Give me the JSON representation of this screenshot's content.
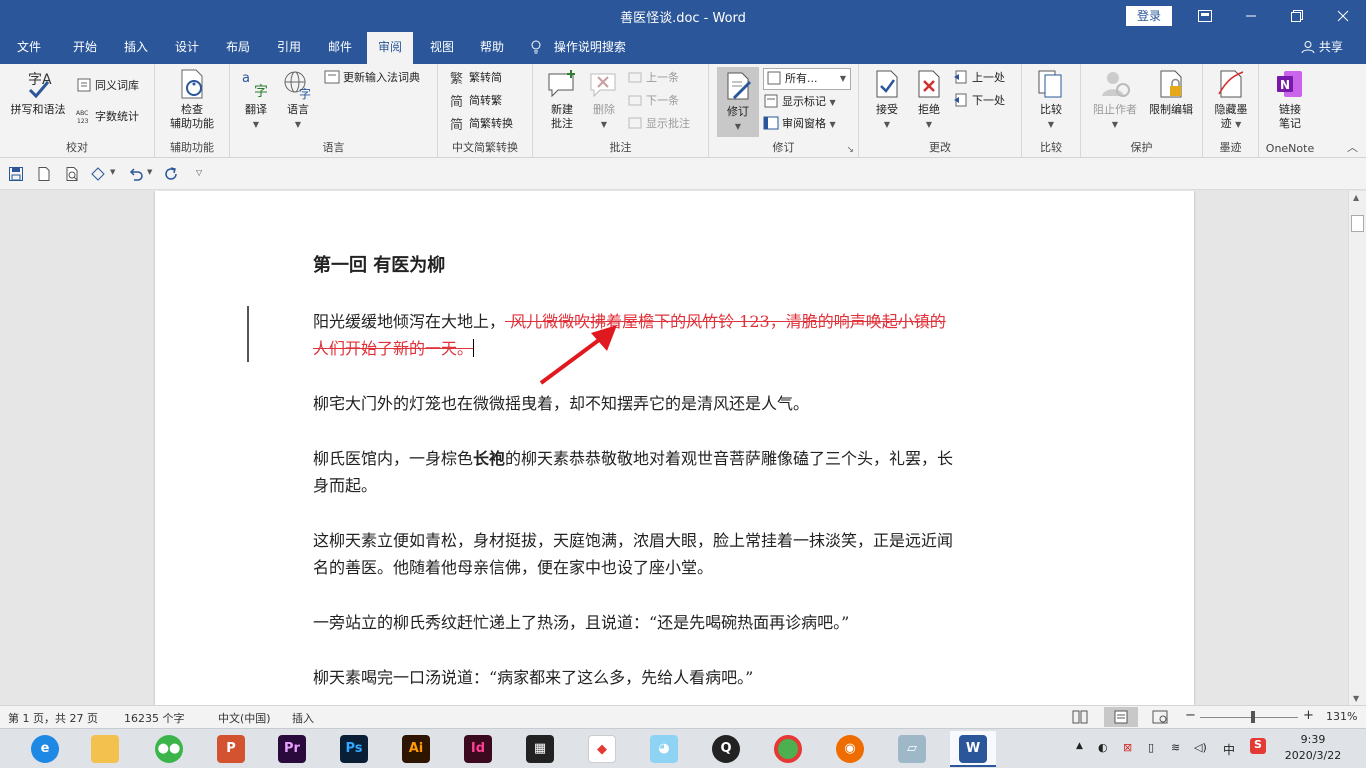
{
  "window": {
    "title": "善医怪谈.doc  -  Word",
    "login_label": "登录"
  },
  "tabs": {
    "file": "文件",
    "home": "开始",
    "insert": "插入",
    "design": "设计",
    "layout": "布局",
    "references": "引用",
    "mailings": "邮件",
    "review": "审阅",
    "view": "视图",
    "help": "帮助",
    "tell_me": "操作说明搜索",
    "share": "共享"
  },
  "ribbon": {
    "proofing": {
      "spelling": "拼写和语法",
      "thesaurus": "同义词库",
      "wordcount": "字数统计",
      "label": "校对"
    },
    "accessibility": {
      "check1": "检查",
      "check2": "辅助功能",
      "label": "辅助功能"
    },
    "language": {
      "translate": "翻译",
      "language": "语言",
      "update_ime": "更新输入法词典",
      "label": "语言"
    },
    "chinese": {
      "to_simplified": "繁转简",
      "to_traditional": "简转繁",
      "convert": "简繁转换",
      "label": "中文简繁转换"
    },
    "comments": {
      "new1": "新建",
      "new2": "批注",
      "delete": "删除",
      "prev": "上一条",
      "next": "下一条",
      "show": "显示批注",
      "label": "批注"
    },
    "tracking": {
      "track": "修订",
      "all_markup": "所有...",
      "show_markup": "显示标记",
      "reviewing_pane": "审阅窗格",
      "label": "修订"
    },
    "changes": {
      "accept": "接受",
      "reject": "拒绝",
      "previous": "上一处",
      "next": "下一处",
      "label": "更改"
    },
    "compare": {
      "compare": "比较",
      "label": "比较"
    },
    "protect": {
      "block1": "阻止作者",
      "restrict": "限制编辑",
      "label": "保护"
    },
    "ink": {
      "hide1": "隐藏墨",
      "hide2": "迹",
      "label": "墨迹"
    },
    "onenote": {
      "link1": "链接",
      "link2": "笔记",
      "label": "OneNote"
    }
  },
  "document": {
    "heading": "第一回  有医为柳",
    "p1_normal": "阳光缓缓地倾泻在大地上，",
    "p1_deleted_a": " 风儿微微吹拂着屋檐下的风竹铃 123，清脆的响声唤起小镇的",
    "p1_deleted_b": "人们开始了新的一天。",
    "p2": "柳宅大门外的灯笼也在微微摇曳着，却不知摆弄它的是清风还是人气。",
    "p3_a": "柳氏医馆内，一身棕色",
    "p3_bold": "长袍",
    "p3_b": "的柳天素恭恭敬敬地对着观世音菩萨雕像磕了三个头，礼罢，长",
    "p3_c": "身而起。",
    "p4_a": "这柳天素立便如青松，身材挺拔，天庭饱满，浓眉大眼，脸上常挂着一抹淡笑，正是远近闻",
    "p4_b": "名的善医。他随着他母亲信佛，便在家中也设了座小堂。",
    "p5": "一旁站立的柳氏秀纹赶忙递上了热汤，且说道：“还是先喝碗热面再诊病吧。”",
    "p6": "柳天素喝完一口汤说道：“病家都来了这么多，先给人看病吧。”"
  },
  "status": {
    "page": "第 1 页，共 27 页",
    "words": "16235 个字",
    "language": "中文(中国)",
    "mode": "插入",
    "zoom": "131%"
  },
  "tray": {
    "ime": "中",
    "time": "9:39",
    "date": "2020/3/22"
  },
  "colors": {
    "accent": "#2b579a",
    "revision": "#e0323a"
  }
}
